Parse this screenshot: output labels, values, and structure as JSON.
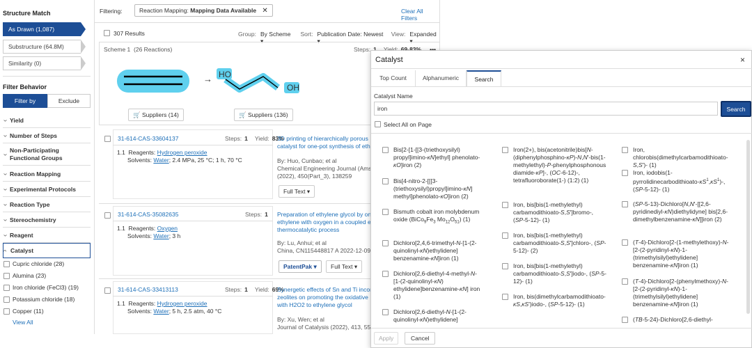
{
  "sidebar": {
    "structure_match_title": "Structure Match",
    "structure_options": [
      {
        "label": "As Drawn (1,087)"
      },
      {
        "label": "Substructure (64.8M)"
      },
      {
        "label": "Similarity (0)"
      }
    ],
    "filter_behavior_title": "Filter Behavior",
    "filter_by_label": "Filter by",
    "exclude_label": "Exclude",
    "facets": [
      "Yield",
      "Number of Steps",
      "Non-Participating Functional Groups",
      "Reaction Mapping",
      "Experimental Protocols",
      "Reaction Type",
      "Stereochemistry",
      "Reagent",
      "Catalyst"
    ],
    "catalyst_options": [
      "Cupric chloride (28)",
      "Alumina (23)",
      "Iron chloride (FeCl3) (19)",
      "Potassium chloride (18)",
      "Copper (11)"
    ],
    "view_all": "View All"
  },
  "main": {
    "filtering_label": "Filtering:",
    "chip_prefix": "Reaction Mapping:",
    "chip_value": "Mapping Data Available",
    "clear_all": "Clear All Filters",
    "results_count": "307 Results",
    "group_label": "Group:",
    "group_value": "By Scheme",
    "sort_label": "Sort:",
    "sort_value": "Publication Date: Newest",
    "view_label": "View:",
    "view_value": "Expanded",
    "scheme_label": "Scheme 1",
    "scheme_count": "(26 Reactions)",
    "steps_label": "Steps:",
    "steps_value": "1",
    "yield_label": "Yield:",
    "yield_value": "69-83%",
    "more": "•••",
    "arrow": "→",
    "ho": "HO",
    "oh": "OH",
    "suppliers_left": "Suppliers (14)",
    "suppliers_right": "Suppliers (136)",
    "reactions": [
      {
        "id": "31-614-CAS-33604137",
        "steps": "1",
        "yield": "83%",
        "reagent": "Hydrogen peroxide",
        "solvent": "Water",
        "conditions": "; 2.4 MPa, 25 °C; 1 h, 70 °C",
        "title": "3D printing of hierarchically porous",
        "title2": "catalyst for one-pot synthesis of eth",
        "authors": "By: Huo, Cunbao; et al",
        "journal": "Chemical Engineering Journal (Amster",
        "journal2": "(2022), 450(Part_3), 138259",
        "btn": "Full Text"
      },
      {
        "id": "31-614-CAS-35082635",
        "steps": "1",
        "yield": "",
        "reagent": "Oxygen",
        "solvent": "Water",
        "conditions": "; 3 h",
        "title": "Preparation of ethylene glycol by on",
        "title2": "ethylene with oxygen in a coupled el",
        "title3": "thermocatalytic process",
        "authors": "By: Lu, Anhui; et al",
        "journal": "China, CN115448817 A 2022-12-09",
        "patentpak": "PatentPak",
        "btn": "Full Text"
      },
      {
        "id": "31-614-CAS-33413113",
        "steps": "1",
        "yield": "69%",
        "reagent": "Hydrogen peroxide",
        "solvent": "Water",
        "conditions": "; 5 h, 2.5 atm, 40 °C",
        "title": "Synergetic effects of Sn and Ti incorp",
        "title2": "zeolites on promoting the oxidative",
        "title3": "with H2O2 to ethylene glycol",
        "authors": "By: Xu, Wen; et al",
        "journal": "Journal of Catalysis (2022), 413, 554-5"
      }
    ],
    "reagents_label": "Reagents:",
    "solvents_label": "Solvents:"
  },
  "modal": {
    "title": "Catalyst",
    "close": "×",
    "tabs": [
      "Top Count",
      "Alphanumeric",
      "Search"
    ],
    "field_label": "Catalyst Name",
    "search_value": "iron",
    "search_button": "Search",
    "select_all": "Select All on Page",
    "apply": "Apply",
    "cancel": "Cancel"
  },
  "colors": {
    "brand": "#1d4e96",
    "link": "#1d6fb8",
    "highlight": "#5fd0ee"
  }
}
